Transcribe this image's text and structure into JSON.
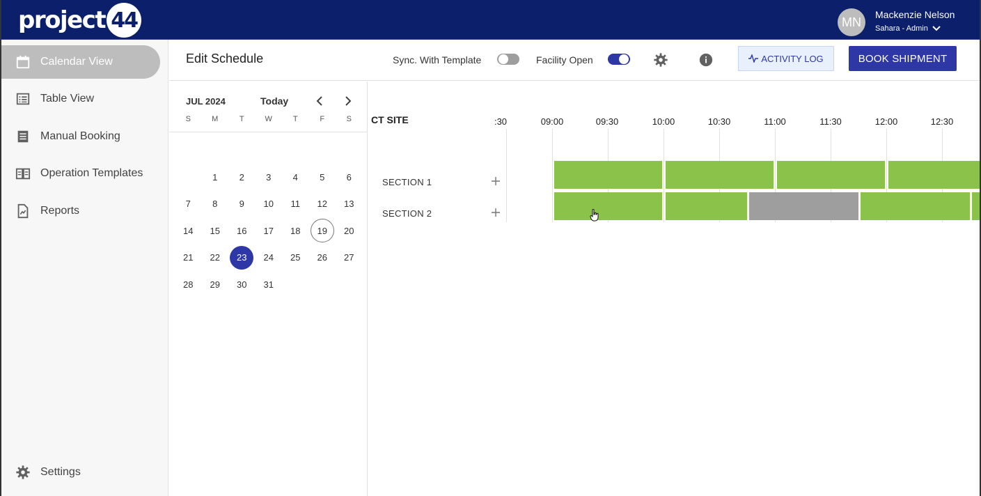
{
  "topbar": {
    "logo_text": "project",
    "logo_number": "44",
    "avatar_initials": "MN",
    "user_name": "Mackenzie Nelson",
    "user_role": "Sahara - Admin",
    "colors": {
      "background": "#0b1f6b"
    }
  },
  "sidebar": {
    "items": [
      {
        "label": "Calendar View",
        "icon": "calendar-icon",
        "active": true
      },
      {
        "label": "Table View",
        "icon": "list-icon",
        "active": false
      },
      {
        "label": "Manual Booking",
        "icon": "document-icon",
        "active": false
      },
      {
        "label": "Operation Templates",
        "icon": "book-icon",
        "active": false
      },
      {
        "label": "Reports",
        "icon": "report-icon",
        "active": false
      }
    ],
    "settings_label": "Settings"
  },
  "header": {
    "title": "Edit Schedule",
    "sync_label": "Sync. With Template",
    "sync_on": false,
    "facility_label": "Facility Open",
    "facility_on": true,
    "activity_log_label": "ACTIVITY LOG",
    "book_shipment_label": "BOOK SHIPMENT",
    "colors": {
      "primary": "#2d37a6",
      "activity_bg": "#e8f0fb"
    }
  },
  "calendar": {
    "month_label": "JUL 2024",
    "today_label": "Today",
    "weekdays": [
      "S",
      "M",
      "T",
      "W",
      "T",
      "F",
      "S"
    ],
    "leading_blanks": 1,
    "days": [
      "1",
      "2",
      "3",
      "4",
      "5",
      "6",
      "7",
      "8",
      "9",
      "10",
      "11",
      "12",
      "13",
      "14",
      "15",
      "16",
      "17",
      "18",
      "19",
      "20",
      "21",
      "22",
      "23",
      "24",
      "25",
      "26",
      "27",
      "28",
      "29",
      "30",
      "31"
    ],
    "today_day": "19",
    "selected_day": "23"
  },
  "timeline": {
    "site_label": "CT SITE",
    "time_labels": [
      ":30",
      "09:00",
      "09:30",
      "10:00",
      "10:30",
      "11:00",
      "11:30",
      "12:00",
      "12:30"
    ],
    "sections": [
      {
        "label": "SECTION 1",
        "slots": [
          {
            "status": "open",
            "color": "#8bc34a"
          },
          {
            "status": "open",
            "color": "#8bc34a"
          },
          {
            "status": "open",
            "color": "#8bc34a"
          },
          {
            "status": "open",
            "color": "#8bc34a"
          }
        ]
      },
      {
        "label": "SECTION 2",
        "slots": [
          {
            "status": "open",
            "color": "#8bc34a"
          },
          {
            "status": "open",
            "color": "#8bc34a"
          },
          {
            "status": "blocked",
            "color": "#9e9e9e"
          },
          {
            "status": "open",
            "color": "#8bc34a"
          },
          {
            "status": "open",
            "color": "#8bc34a"
          }
        ]
      }
    ]
  }
}
